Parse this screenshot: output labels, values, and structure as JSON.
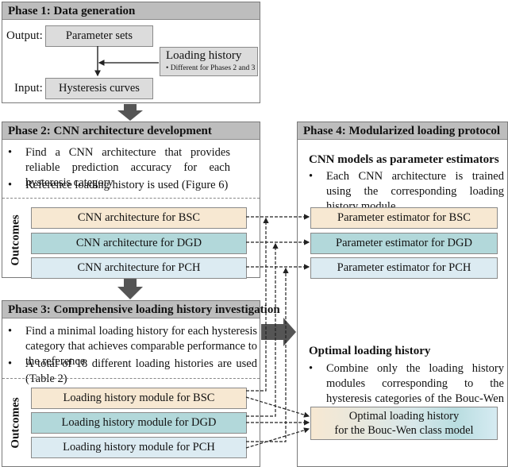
{
  "phase1": {
    "title": "Phase 1: Data generation",
    "output_label": "Output:",
    "input_label": "Input:",
    "parameter_sets": "Parameter sets",
    "hysteresis_curves": "Hysteresis curves",
    "loading_history": "Loading history",
    "loading_history_note": "Different for Phases 2 and 3"
  },
  "phase2": {
    "title": "Phase 2: CNN architecture development",
    "bullets": [
      "Find a CNN architecture that provides reliable prediction accuracy for each hysteresis category",
      "Reference loading history is used (Figure 6)"
    ],
    "outcomes_label": "Outcomes",
    "outcomes": [
      "CNN architecture for BSC",
      "CNN architecture for DGD",
      "CNN architecture for PCH"
    ]
  },
  "phase3": {
    "title": "Phase 3: Comprehensive loading history investigation",
    "bullets": [
      "Find a minimal loading history for each hysteresis category that achieves comparable performance to the reference",
      "A total of 18 different loading histories are used (Table 2)"
    ],
    "outcomes_label": "Outcomes",
    "outcomes": [
      "Loading history module for BSC",
      "Loading history module for DGD",
      "Loading history module for PCH"
    ]
  },
  "phase4": {
    "title": "Phase 4: Modularized loading protocol",
    "section1_title": "CNN models as parameter estimators",
    "section1_bullet": "Each CNN architecture is trained using the corresponding loading history module",
    "estimators": [
      "Parameter estimator for BSC",
      "Parameter estimator for DGD",
      "Parameter estimator for PCH"
    ],
    "section2_title": "Optimal loading history",
    "section2_bullet": "Combine only the loading history modules corresponding to the hysteresis categories of the Bouc-Wen model of interest",
    "optimal_box_line1": "Optimal loading history",
    "optimal_box_line2": "for the Bouc-Wen class model"
  },
  "bullet_char": "•",
  "colors": {
    "header_gray": "#bdbdbd",
    "box_gray": "#dcdcdc",
    "bsc": "#f7e8d2",
    "dgd": "#b2d8da",
    "pch": "#dcebf2",
    "arrow": "#555555"
  }
}
